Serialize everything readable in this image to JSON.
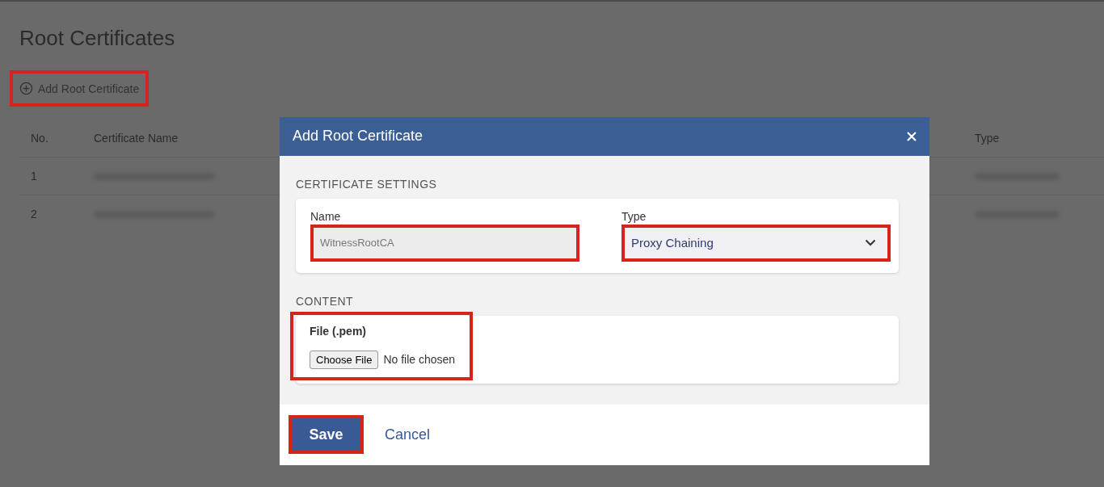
{
  "page": {
    "title": "Root Certificates",
    "add_button": {
      "label": "Add Root Certificate",
      "highlighted": true
    }
  },
  "table": {
    "columns": [
      "No.",
      "Certificate Name",
      "Type"
    ],
    "rows": [
      {
        "no": "1",
        "name_redacted": true,
        "type_redacted": true
      },
      {
        "no": "2",
        "name_redacted": true,
        "type_redacted": true
      }
    ]
  },
  "dialog": {
    "title": "Add Root Certificate",
    "sections": [
      {
        "heading": "CERTIFICATE SETTINGS",
        "fields": [
          {
            "kind": "text",
            "label": "Name",
            "value": "WitnessRootCA",
            "highlighted": true
          },
          {
            "kind": "select",
            "label": "Type",
            "value": "Proxy Chaining",
            "highlighted": true
          }
        ]
      },
      {
        "heading": "CONTENT",
        "fields": [
          {
            "kind": "file",
            "label": "File (.pem)",
            "button": "Choose File",
            "status": "No file chosen",
            "highlighted": true
          }
        ]
      }
    ],
    "buttons": [
      {
        "kind": "primary",
        "label": "Save",
        "highlighted": true
      },
      {
        "kind": "link",
        "label": "Cancel",
        "highlighted": false
      }
    ]
  }
}
